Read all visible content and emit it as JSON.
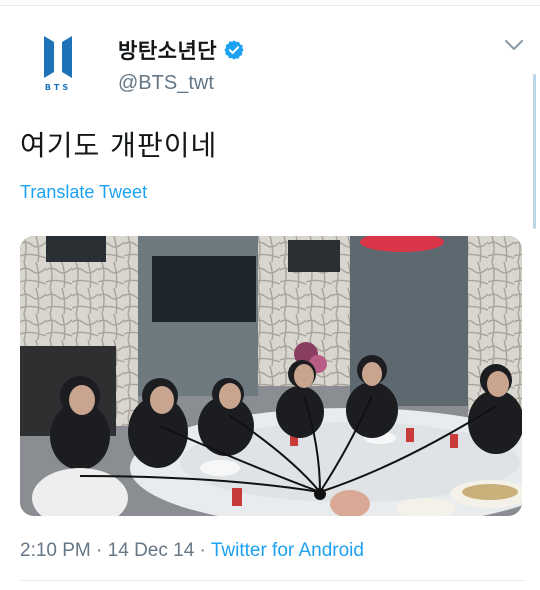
{
  "tweet": {
    "display_name": "방탄소년단",
    "handle": "@BTS_twt",
    "logo_text": "BTS",
    "text": "여기도 개판이네",
    "translate_label": "Translate Tweet",
    "time": "2:10 PM",
    "date": "14 Dec 14",
    "separator": " · ",
    "source": "Twitter for Android"
  },
  "icons": {
    "verified": "verified-badge-icon",
    "caret": "chevron-down-icon"
  },
  "colors": {
    "link": "#1da1f2",
    "secondary_text": "#657786",
    "logo_blue": "#1e73b8",
    "verified": "#1da1f2"
  }
}
